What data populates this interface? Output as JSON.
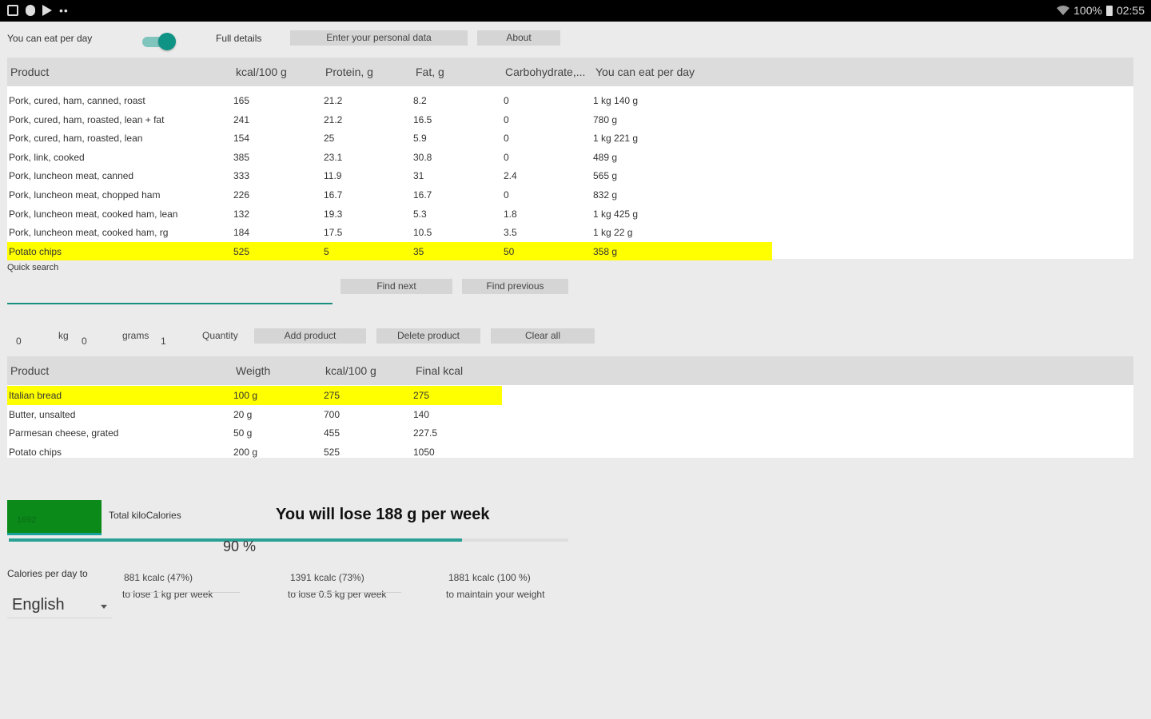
{
  "status_bar": {
    "battery": "100%",
    "time": "02:55"
  },
  "top": {
    "can_eat_label": "You can eat per day",
    "full_details_label": "Full details",
    "enter_data_button": "Enter your personal data",
    "about_button": "About"
  },
  "products_table": {
    "headers": [
      "Product",
      "kcal/100 g",
      "Protein, g",
      "Fat, g",
      "Carbohydrate,...",
      "You can eat per day"
    ],
    "rows": [
      [
        "Pork, cured, ham, canned, roast",
        "165",
        "21.2",
        "8.2",
        "0",
        "1 kg 140 g"
      ],
      [
        "Pork, cured, ham, roasted, lean + fat",
        "241",
        "21.2",
        "16.5",
        "0",
        "780 g"
      ],
      [
        "Pork, cured, ham, roasted, lean",
        "154",
        "25",
        "5.9",
        "0",
        "1 kg 221 g"
      ],
      [
        "Pork, link, cooked",
        "385",
        "23.1",
        "30.8",
        "0",
        "489 g"
      ],
      [
        "Pork, luncheon meat, canned",
        "333",
        "11.9",
        "31",
        "2.4",
        "565 g"
      ],
      [
        "Pork, luncheon meat, chopped ham",
        "226",
        "16.7",
        "16.7",
        "0",
        "832 g"
      ],
      [
        "Pork, luncheon meat, cooked ham, lean",
        "132",
        "19.3",
        "5.3",
        "1.8",
        "1 kg 425 g"
      ],
      [
        "Pork, luncheon meat, cooked ham, rg",
        "184",
        "17.5",
        "10.5",
        "3.5",
        "1 kg 22 g"
      ],
      [
        "Potato chips",
        "525",
        "5",
        "35",
        "50",
        "358 g"
      ]
    ]
  },
  "search": {
    "quick_search_label": "Quick search",
    "find_next_button": "Find next",
    "find_previous_button": "Find previous"
  },
  "quantity": {
    "kg_value": "0",
    "kg_label": "kg",
    "grams_value": "0",
    "grams_label": "grams",
    "count_value": "1",
    "quantity_label": "Quantity",
    "add_button": "Add product",
    "delete_button": "Delete product",
    "clear_button": "Clear all"
  },
  "meal_table": {
    "headers": [
      "Product",
      "Weigth",
      "kcal/100 g",
      "Final kcal"
    ],
    "rows": [
      [
        "Italian bread",
        "100 g",
        "275",
        "275"
      ],
      [
        "Butter, unsalted",
        "20 g",
        "700",
        "140"
      ],
      [
        "Parmesan cheese, grated",
        "50 g",
        "455",
        "227.5"
      ],
      [
        "Potato chips",
        "200 g",
        "525",
        "1050"
      ]
    ]
  },
  "totals": {
    "total_value": "1692",
    "total_label": "Total kiloCalories",
    "lose_message": "You will lose 188 g per week",
    "progress_text": "90 %",
    "progress_fraction": 0.9
  },
  "calories": {
    "label": "Calories per day to",
    "option1_value": "881 kcalc (47%)",
    "option1_desc": "to lose 1 kg per week",
    "option2_value": "1391 kcalc (73%)",
    "option2_desc": "to lose 0.5 kg per week",
    "option3_value": "1881 kcalc (100 %)",
    "option3_desc": "to maintain your weight"
  },
  "language": {
    "selected": "English"
  }
}
